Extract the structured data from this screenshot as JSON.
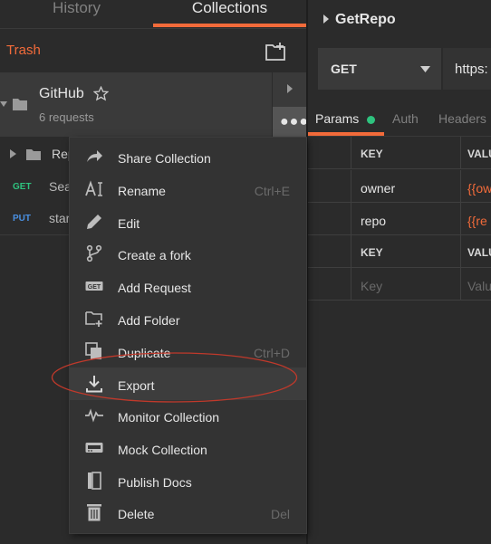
{
  "sidebar": {
    "tabs": {
      "history": "History",
      "collections": "Collections"
    },
    "trash_label": "Trash",
    "collection": {
      "name": "GitHub",
      "count": "6 requests"
    },
    "items": [
      {
        "type": "folder",
        "name": "Rep"
      },
      {
        "method": "GET",
        "name": "Sea"
      },
      {
        "method": "PUT",
        "name": "star"
      }
    ]
  },
  "context_menu": {
    "items": [
      {
        "label": "Share Collection",
        "icon": "share-arrow-icon",
        "shortcut": ""
      },
      {
        "label": "Rename",
        "icon": "rename-cursor-icon",
        "shortcut": "Ctrl+E"
      },
      {
        "label": "Edit",
        "icon": "pencil-icon",
        "shortcut": ""
      },
      {
        "label": "Create a fork",
        "icon": "fork-icon",
        "shortcut": ""
      },
      {
        "label": "Add Request",
        "icon": "get-request-icon",
        "shortcut": ""
      },
      {
        "label": "Add Folder",
        "icon": "add-folder-icon",
        "shortcut": ""
      },
      {
        "label": "Duplicate",
        "icon": "duplicate-icon",
        "shortcut": "Ctrl+D"
      },
      {
        "label": "Export",
        "icon": "download-icon",
        "shortcut": "",
        "highlighted": true
      },
      {
        "label": "Monitor Collection",
        "icon": "pulse-icon",
        "shortcut": ""
      },
      {
        "label": "Mock Collection",
        "icon": "server-icon",
        "shortcut": ""
      },
      {
        "label": "Publish Docs",
        "icon": "docs-icon",
        "shortcut": ""
      },
      {
        "label": "Delete",
        "icon": "trash-icon",
        "shortcut": "Del"
      }
    ]
  },
  "request": {
    "title": "GetRepo",
    "method": "GET",
    "url": "https:",
    "tabs": {
      "params": "Params",
      "auth": "Auth",
      "headers": "Headers"
    },
    "params_table": {
      "header_key": "KEY",
      "header_value": "VALU",
      "rows": [
        {
          "key": "owner",
          "value": "{{ow"
        },
        {
          "key": "repo",
          "value": "{{re"
        }
      ],
      "placeholder_key": "Key",
      "placeholder_value": "Valu"
    }
  },
  "colors": {
    "accent": "#f26b3a",
    "get": "#2ec27e",
    "put": "#4a90e2",
    "annotation": "#c0392b"
  }
}
